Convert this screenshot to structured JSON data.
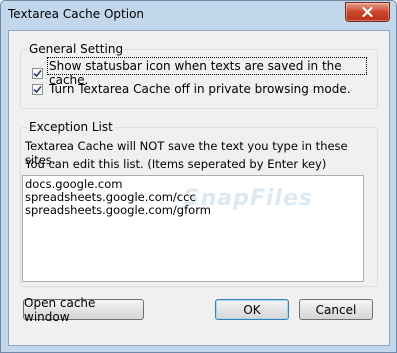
{
  "window": {
    "title": "Textarea Cache Option"
  },
  "general": {
    "label": "General Setting",
    "options": [
      {
        "label": "Show statusbar icon when texts are saved in the cache.",
        "checked": true
      },
      {
        "label": "Turn Textarea Cache off in private browsing mode.",
        "checked": true
      }
    ]
  },
  "exception": {
    "label": "Exception List",
    "desc1": "Textarea Cache will NOT save the text you type in these sites.",
    "desc2": "You can edit this list. (Items seperated by Enter key)",
    "sites": [
      "docs.google.com",
      "spreadsheets.google.com/ccc",
      "spreadsheets.google.com/gform"
    ]
  },
  "watermark": "SnapFiles",
  "buttons": {
    "open_cache": "Open cache window",
    "ok": "OK",
    "cancel": "Cancel"
  },
  "icons": {
    "close": "close-icon",
    "check": "check-icon"
  }
}
